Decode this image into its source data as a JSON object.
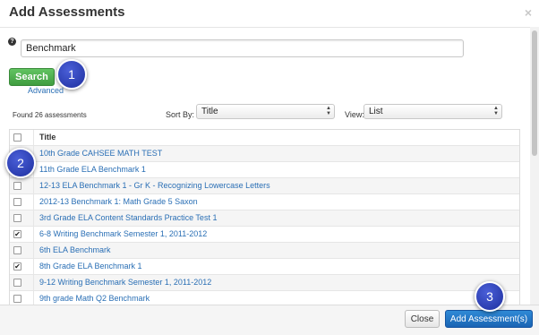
{
  "dialog": {
    "title": "Add Assessments",
    "close_glyph": "×"
  },
  "search": {
    "help_icon_glyph": "?",
    "value": "Benchmark",
    "button_label": "Search",
    "advanced_label": "Advanced"
  },
  "results": {
    "found_text": "Found 26 assessments",
    "sort_label": "Sort By:",
    "sort_value": "Title",
    "view_label": "View:",
    "view_value": "List"
  },
  "table": {
    "header": "Title",
    "rows": [
      {
        "title": "10th Grade CAHSEE MATH TEST",
        "checked": false
      },
      {
        "title": "11th Grade ELA Benchmark 1",
        "checked": false
      },
      {
        "title": "12-13 ELA Benchmark 1 - Gr K - Recognizing Lowercase Letters",
        "checked": false
      },
      {
        "title": "2012-13 Benchmark 1: Math Grade 5 Saxon",
        "checked": false
      },
      {
        "title": "3rd Grade ELA Content Standards Practice Test 1",
        "checked": false
      },
      {
        "title": "6-8 Writing Benchmark Semester 1, 2011-2012",
        "checked": true
      },
      {
        "title": "6th ELA Benchmark",
        "checked": false
      },
      {
        "title": "8th Grade ELA Benchmark 1",
        "checked": true
      },
      {
        "title": "9-12 Writing Benchmark Semester 1, 2011-2012",
        "checked": false
      },
      {
        "title": "9th grade Math Q2 Benchmark",
        "checked": false
      }
    ]
  },
  "footer": {
    "close_label": "Close",
    "add_label": "Add Assessment(s)"
  },
  "callouts": [
    "1",
    "2",
    "3"
  ],
  "colors": {
    "link": "#2a6fb5",
    "search_button": "#4cae4c",
    "primary_button": "#1f6fc2",
    "callout": "#2a3fc0"
  },
  "icons": {
    "help": "help-icon",
    "close": "close-icon",
    "select": "select-arrows-icon",
    "check": "checkmark-icon"
  }
}
